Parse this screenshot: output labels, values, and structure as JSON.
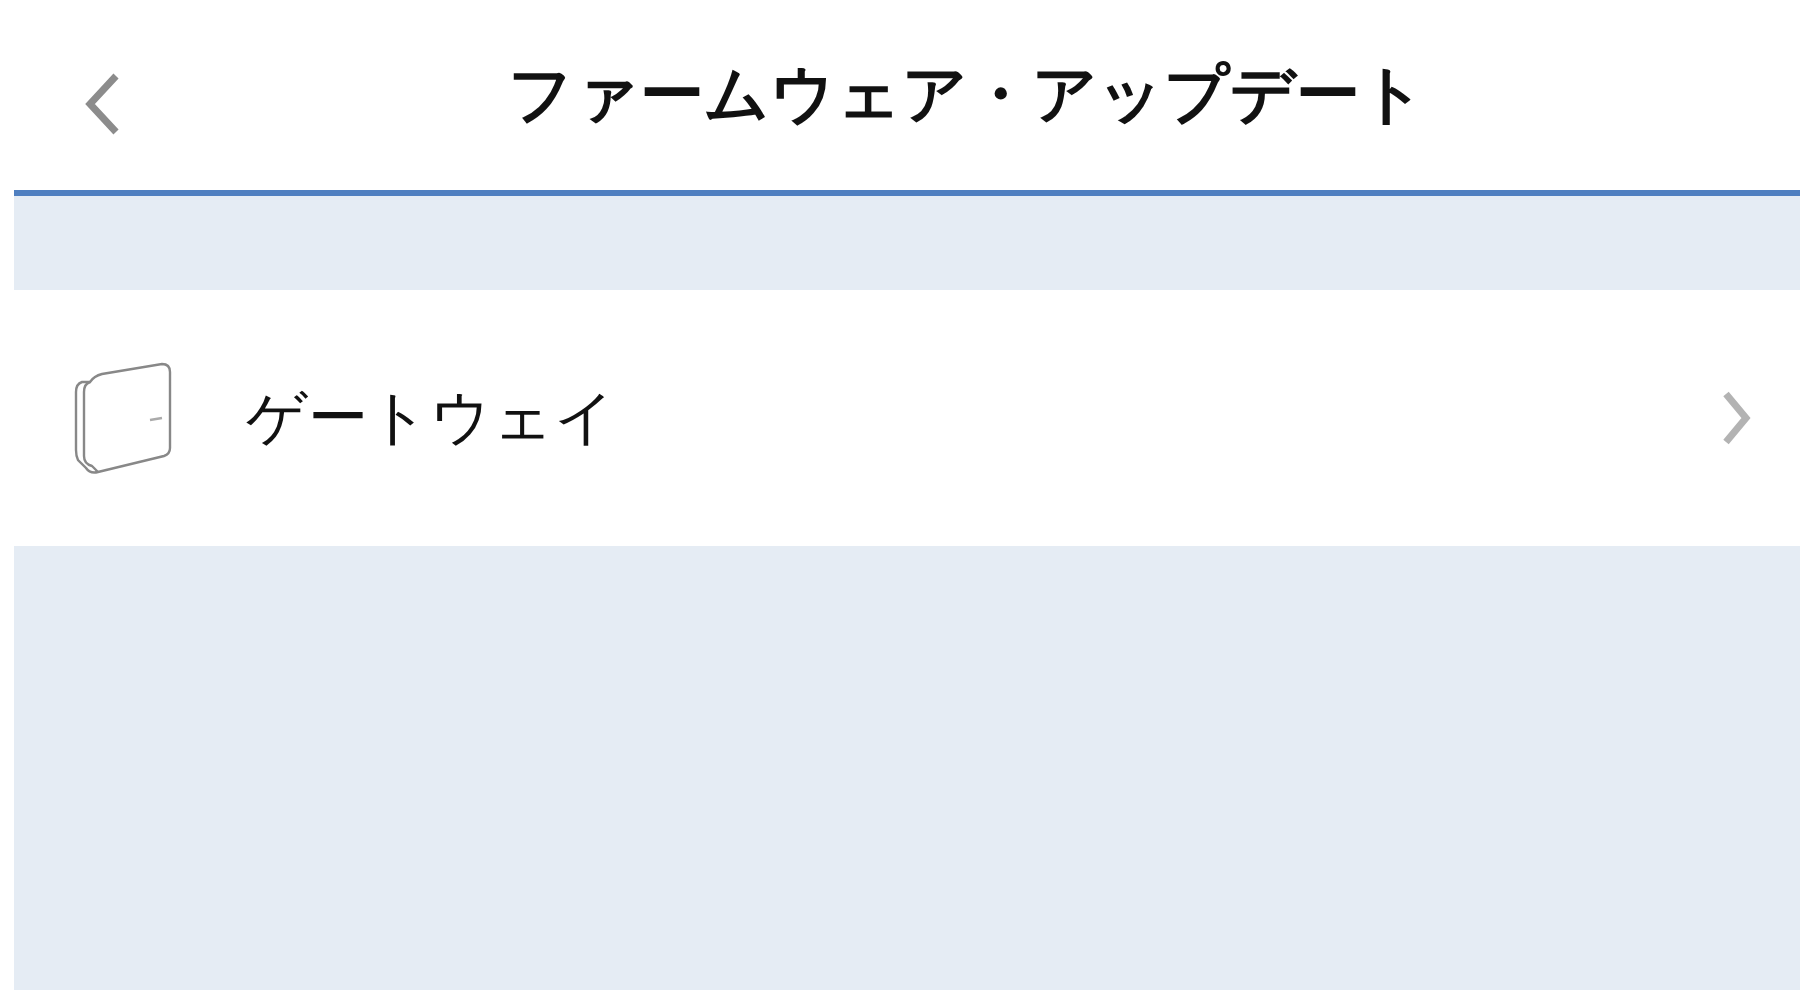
{
  "header": {
    "title": "ファームウェア・アップデート"
  },
  "devices": [
    {
      "name": "ゲートウェイ"
    }
  ]
}
